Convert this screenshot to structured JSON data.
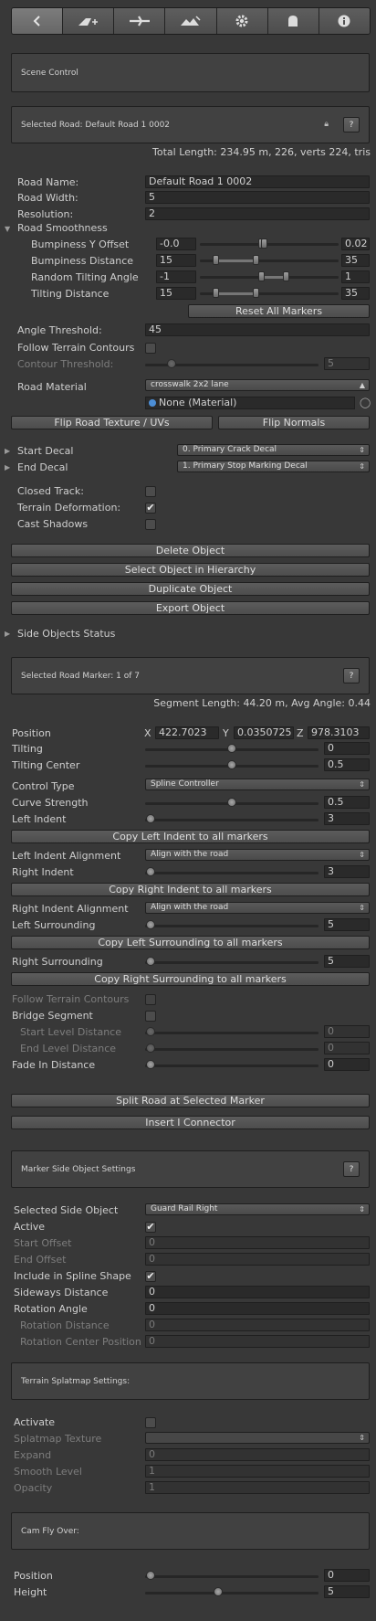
{
  "toolbar": {
    "buttons": [
      {
        "icon": "back-arrow-icon",
        "active": true
      },
      {
        "icon": "add-road-icon"
      },
      {
        "icon": "connector-icon"
      },
      {
        "icon": "terrain-icon"
      },
      {
        "icon": "gear-icon"
      },
      {
        "icon": "ghost-icon"
      },
      {
        "icon": "info-icon"
      }
    ]
  },
  "scene_control": {
    "title": "Scene Control"
  },
  "selected_road": {
    "title": "Selected Road:  Default Road 1 0002",
    "help": "?",
    "total_length": "Total Length: 234.95 m, 226, verts 224, tris"
  },
  "road": {
    "name_label": "Road Name:",
    "name_value": "Default Road 1 0002",
    "width_label": "Road Width:",
    "width_value": "5",
    "resolution_label": "Resolution:",
    "resolution_value": "2",
    "smoothness_label": "Road Smoothness",
    "bumpiness_y_label": "Bumpiness Y Offset",
    "bumpiness_y_min": "-0.0",
    "bumpiness_y_max": "0.02",
    "bumpiness_distance_label": "Bumpiness Distance",
    "bumpiness_distance_min": "15",
    "bumpiness_distance_max": "35",
    "random_tilting_label": "Random Tilting Angle",
    "random_tilting_min": "-1",
    "random_tilting_max": "1",
    "tilting_distance_label": "Tilting Distance",
    "tilting_distance_min": "15",
    "tilting_distance_max": "35",
    "reset_markers_label": "Reset All Markers",
    "angle_threshold_label": "Angle Threshold:",
    "angle_threshold_value": "45",
    "follow_terrain_label": "Follow Terrain Contours",
    "contour_threshold_label": "Contour Threshold:",
    "contour_threshold_value": "5",
    "road_material_label": "Road Material",
    "road_material_value": "crosswalk 2x2 lane",
    "material_object_value": "None (Material)",
    "flip_texture_label": "Flip Road Texture / UVs",
    "flip_normals_label": "Flip Normals",
    "start_decal_label": "Start Decal",
    "start_decal_value": "0. Primary Crack Decal",
    "end_decal_label": "End Decal",
    "end_decal_value": "1. Primary Stop Marking Decal",
    "closed_track_label": "Closed Track:",
    "closed_track_checked": false,
    "terrain_deformation_label": "Terrain Deformation:",
    "terrain_deformation_checked": true,
    "cast_shadows_label": "Cast Shadows",
    "cast_shadows_checked": false,
    "delete_object_label": "Delete Object",
    "select_hierarchy_label": "Select Object in Hierarchy",
    "duplicate_object_label": "Duplicate Object",
    "export_object_label": "Export Object",
    "side_objects_status_label": "Side Objects Status"
  },
  "marker": {
    "title": "Selected Road Marker: 1 of 7",
    "help": "?",
    "segment_length": "Segment Length: 44.20 m, Avg Angle: 0.44",
    "position_label": "Position",
    "pos_x_label": "X",
    "pos_x_value": "422.7023",
    "pos_y_label": "Y",
    "pos_y_value": "0.0350725",
    "pos_z_label": "Z",
    "pos_z_value": "978.3103",
    "tilting_label": "Tilting",
    "tilting_value": "0",
    "tilting_center_label": "Tilting Center",
    "tilting_center_value": "0.5",
    "control_type_label": "Control Type",
    "control_type_value": "Spline Controller",
    "curve_strength_label": "Curve Strength",
    "curve_strength_value": "0.5",
    "left_indent_label": "Left Indent",
    "left_indent_value": "3",
    "copy_left_indent_label": "Copy Left Indent to all markers",
    "left_indent_alignment_label": "Left Indent Alignment",
    "left_indent_alignment_value": "Align with the road",
    "right_indent_label": "Right Indent",
    "right_indent_value": "3",
    "copy_right_indent_label": "Copy Right Indent to all markers",
    "right_indent_alignment_label": "Right Indent Alignment",
    "right_indent_alignment_value": "Align with the road",
    "left_surrounding_label": "Left Surrounding",
    "left_surrounding_value": "5",
    "copy_left_surrounding_label": "Copy Left Surrounding to all markers",
    "right_surrounding_label": "Right Surrounding",
    "right_surrounding_value": "5",
    "copy_right_surrounding_label": "Copy Right Surrounding to all markers",
    "follow_terrain_label": "Follow Terrain Contours",
    "bridge_segment_label": "Bridge Segment",
    "start_level_label": "Start Level Distance",
    "start_level_value": "0",
    "end_level_label": "End Level Distance",
    "end_level_value": "0",
    "fade_in_label": "Fade In Distance",
    "fade_in_value": "0",
    "split_road_label": "Split Road at Selected Marker",
    "insert_connector_label": "Insert I Connector"
  },
  "side_object": {
    "title": "Marker Side Object Settings",
    "help": "?",
    "selected_label": "Selected Side Object",
    "selected_value": "Guard Rail Right",
    "active_label": "Active",
    "active_checked": true,
    "start_offset_label": "Start Offset",
    "start_offset_value": "0",
    "end_offset_label": "End Offset",
    "end_offset_value": "0",
    "include_spline_label": "Include in Spline Shape",
    "include_spline_checked": true,
    "sideways_label": "Sideways Distance",
    "sideways_value": "0",
    "rotation_angle_label": "Rotation Angle",
    "rotation_angle_value": "0",
    "rotation_distance_label": "Rotation Distance",
    "rotation_distance_value": "0",
    "rotation_center_label": "Rotation Center Position",
    "rotation_center_value": "0"
  },
  "terrain_splatmap": {
    "title": "Terrain Splatmap Settings:",
    "activate_label": "Activate",
    "texture_label": "Splatmap Texture",
    "expand_label": "Expand",
    "expand_value": "0",
    "smooth_label": "Smooth Level",
    "smooth_value": "1",
    "opacity_label": "Opacity",
    "opacity_value": "1"
  },
  "cam_fly_over": {
    "title": "Cam Fly Over:",
    "position_label": "Position",
    "position_value": "0",
    "height_label": "Height",
    "height_value": "5"
  }
}
